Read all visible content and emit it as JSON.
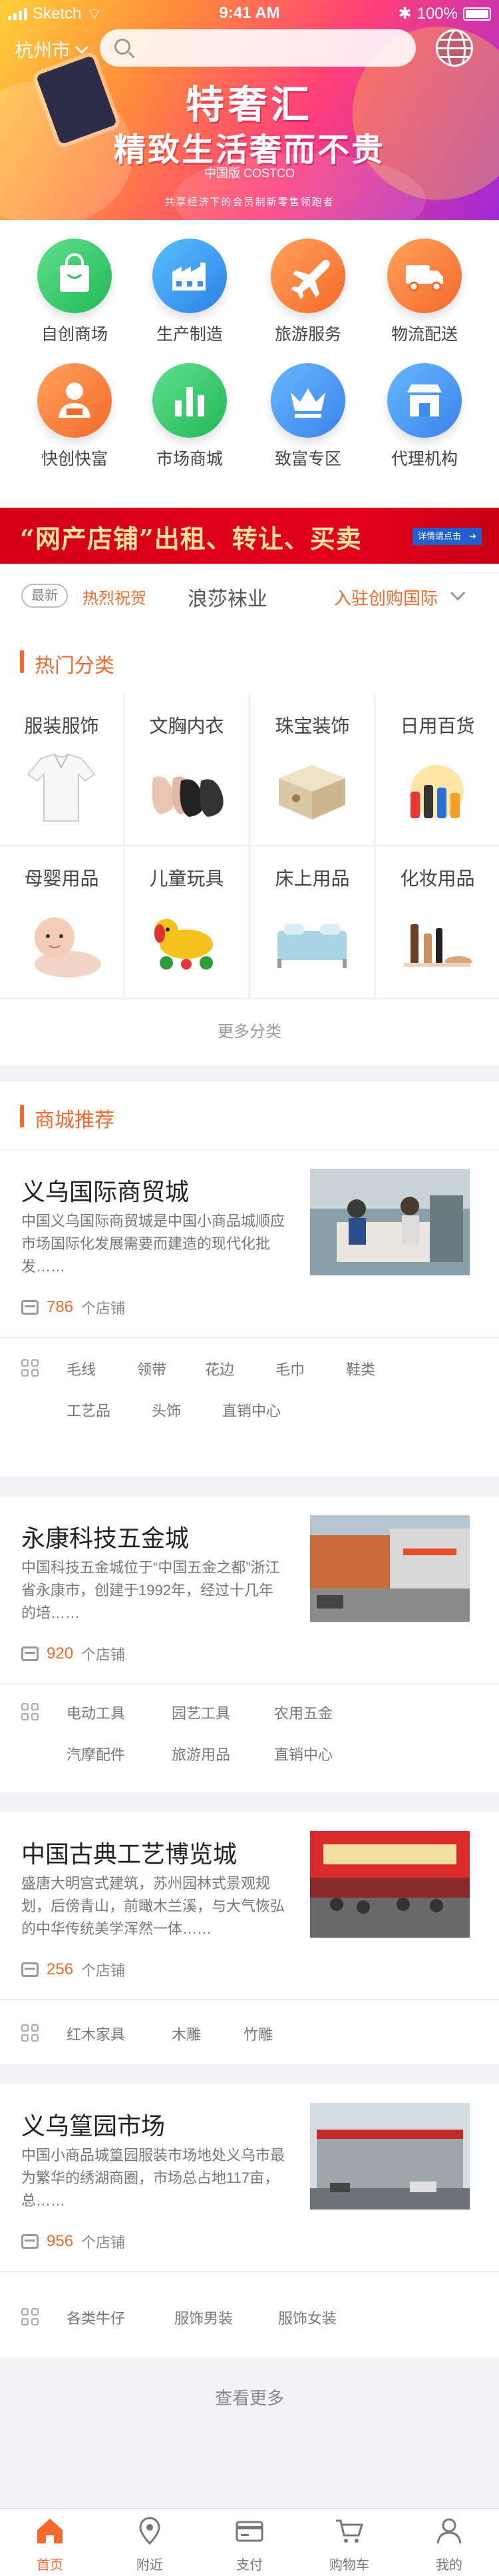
{
  "status": {
    "carrier": "Sketch",
    "time": "9:41 AM",
    "battery": "100%"
  },
  "header": {
    "city": "杭州市",
    "search_placeholder": ""
  },
  "hero": {
    "title": "特奢汇",
    "subtitle": "精致生活奢而不贵",
    "brand": "中国版 COSTCO",
    "slogan": "共享经济下的会员制新零售领跑者"
  },
  "categories": [
    {
      "label": "自创商场",
      "icon": "shopping-bag-icon",
      "color": "#2bbd5f"
    },
    {
      "label": "生产制造",
      "icon": "factory-icon",
      "color": "#3c8ee9"
    },
    {
      "label": "旅游服务",
      "icon": "airplane-icon",
      "color": "#f46a2a"
    },
    {
      "label": "物流配送",
      "icon": "truck-icon",
      "color": "#f46a2a"
    },
    {
      "label": "快创快富",
      "icon": "person-icon",
      "color": "#f46a2a"
    },
    {
      "label": "市场商城",
      "icon": "bar-chart-icon",
      "color": "#2bbd5f"
    },
    {
      "label": "致富专区",
      "icon": "crown-icon",
      "color": "#3c8ee9"
    },
    {
      "label": "代理机构",
      "icon": "storefront-icon",
      "color": "#3c8ee9"
    }
  ],
  "banner": {
    "text": "“网产店铺”出租、转让、买卖",
    "button": "详情请点击"
  },
  "ticker": {
    "badge": "最新",
    "tag": "热烈祝贺",
    "text": "浪莎袜业",
    "link": "入驻创购国际"
  },
  "hot": {
    "title": "热门分类",
    "items": [
      {
        "label": "服装服饰"
      },
      {
        "label": "文胸内衣"
      },
      {
        "label": "珠宝装饰"
      },
      {
        "label": "日用百货"
      },
      {
        "label": "母婴用品"
      },
      {
        "label": "儿童玩具"
      },
      {
        "label": "床上用品"
      },
      {
        "label": "化妆用品"
      }
    ],
    "more": "更多分类"
  },
  "malls": {
    "title": "商城推荐",
    "unit": "个店铺",
    "items": [
      {
        "name": "义乌国际商贸城",
        "desc": "中国义乌国际商贸城是中国小商品城顺应市场国际化发展需要而建造的现代化批发……",
        "shops": "786",
        "tags": [
          "毛线",
          "领带",
          "花边",
          "毛巾",
          "鞋类",
          "工艺品",
          "头饰",
          "直销中心"
        ]
      },
      {
        "name": "永康科技五金城",
        "desc": "中国科技五金城位于“中国五金之都”浙江省永康市，创建于1992年，经过十几年的培……",
        "shops": "920",
        "tags": [
          "电动工具",
          "园艺工具",
          "农用五金",
          "汽摩配件",
          "旅游用品",
          "直销中心"
        ]
      },
      {
        "name": "中国古典工艺博览城",
        "desc": "盛唐大明宫式建筑，苏州园林式景观规划，后傍青山，前瞰木兰溪，与大气恢弘的中华传统美学浑然一体……",
        "shops": "256",
        "tags": [
          "红木家具",
          "木雕",
          "竹雕"
        ]
      },
      {
        "name": "义乌篁园市场",
        "desc": "中国小商品城篁园服装市场地处义乌市最为繁华的绣湖商圈，市场总占地117亩，总……",
        "shops": "956",
        "tags": [
          "各类牛仔",
          "服饰男装",
          "服饰女装"
        ]
      }
    ],
    "more": "查看更多"
  },
  "tabs": [
    {
      "label": "首页",
      "icon": "home-icon",
      "active": true
    },
    {
      "label": "附近",
      "icon": "location-pin-icon",
      "active": false
    },
    {
      "label": "支付",
      "icon": "wallet-icon",
      "active": false
    },
    {
      "label": "购物车",
      "icon": "cart-icon",
      "active": false
    },
    {
      "label": "我的",
      "icon": "user-icon",
      "active": false
    }
  ],
  "colors": {
    "accent": "#f46a2a",
    "banner_red": "#e3001a",
    "text": "#333333"
  }
}
